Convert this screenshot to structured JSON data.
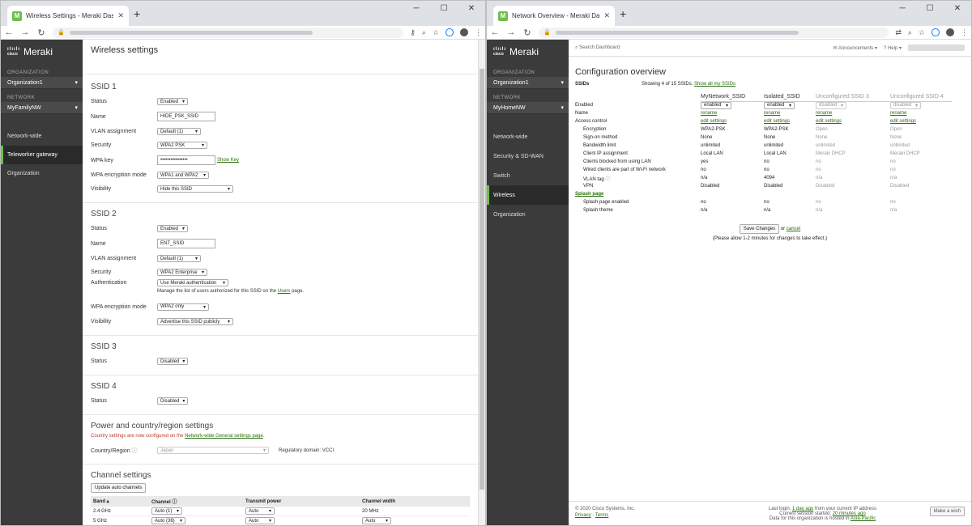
{
  "left": {
    "tab_title": "Wireless Settings - Meraki Dashb",
    "brand": "Meraki",
    "org_label": "ORGANIZATION",
    "org_value": "Organization1",
    "net_label": "NETWORK",
    "net_value": "MyFamilyNW",
    "nav": [
      "Network-wide",
      "Teleworker gateway",
      "Organization"
    ],
    "page_title": "Wireless settings",
    "ssid1": {
      "title": "SSID 1",
      "status_label": "Status",
      "status": "Enabled",
      "name_label": "Name",
      "name": "HIDE_PSK_SSID",
      "vlan_label": "VLAN assignment",
      "vlan": "Default (1)",
      "security_label": "Security",
      "security": "WPA2 PSK",
      "wpakey_label": "WPA key",
      "wpakey": "••••••••••••••••",
      "show_key": "Show Key",
      "enc_label": "WPA encryption mode",
      "enc": "WPA1 and WPA2",
      "vis_label": "Visibility",
      "vis": "Hide this SSID"
    },
    "ssid2": {
      "title": "SSID 2",
      "status_label": "Status",
      "status": "Enabled",
      "name_label": "Name",
      "name": "ENT_SSID",
      "vlan_label": "VLAN assignment",
      "vlan": "Default (1)",
      "security_label": "Security",
      "security": "WPA2 Enterprise",
      "auth_label": "Authentication",
      "auth": "Use Meraki authentication",
      "manage_pre": "Manage the list of users authorized for this SSID on the ",
      "manage_link": "Users",
      "manage_post": " page.",
      "enc_label": "WPA encryption mode",
      "enc": "WPA2 only",
      "vis_label": "Visibility",
      "vis": "Advertise this SSID publicly"
    },
    "ssid3": {
      "title": "SSID 3",
      "status_label": "Status",
      "status": "Disabled"
    },
    "ssid4": {
      "title": "SSID 4",
      "status_label": "Status",
      "status": "Disabled"
    },
    "power": {
      "title": "Power and country/region settings",
      "note_pre": "Country settings are now configured on the ",
      "note_link": "Network-wide General settings page",
      "note_post": ".",
      "country_label": "Country/Region",
      "country": "Japan",
      "reg": "Regulatory domain: VCCI"
    },
    "channel": {
      "title": "Channel settings",
      "update_btn": "Update auto channels",
      "headers": [
        "Band ▴",
        "Channel",
        "Transmit power",
        "Channel width"
      ],
      "rows": [
        {
          "band": "2.4 GHz",
          "channel": "Auto (1)",
          "power": "Auto",
          "width": "20 MHz"
        },
        {
          "band": "5 GHz",
          "channel": "Auto (36)",
          "power": "Auto",
          "width": "Auto"
        }
      ]
    }
  },
  "right": {
    "tab_title": "Network Overview - Meraki Dash",
    "brand": "Meraki",
    "org_label": "ORGANIZATION",
    "org_value": "Organization1",
    "net_label": "NETWORK",
    "net_value": "MyHomeNW",
    "nav": [
      "Network-wide",
      "Security & SD-WAN",
      "Switch",
      "Wireless",
      "Organization"
    ],
    "search": "Search Dashboard",
    "announcements": "Announcements",
    "help": "Help",
    "title": "Configuration overview",
    "ssids_label": "SSIDs",
    "showing": "Showing 4 of 15 SSIDs.",
    "show_all": "Show all my SSIDs",
    "columns": [
      "MyNetwork_SSID",
      "Isolated_SSID",
      "Unconfigured SSID 3",
      "Unconfigured SSID 4"
    ],
    "rows": [
      {
        "label": "Enabled",
        "indent": false,
        "vals": [
          "enabled",
          "enabled",
          "disabled",
          "disabled"
        ],
        "kind": "select"
      },
      {
        "label": "Name",
        "indent": false,
        "vals": [
          "rename",
          "rename",
          "rename",
          "rename"
        ],
        "kind": "link"
      },
      {
        "label": "Access control",
        "indent": false,
        "vals": [
          "edit settings",
          "edit settings",
          "edit settings",
          "edit settings"
        ],
        "kind": "link"
      },
      {
        "label": "Encryption",
        "indent": true,
        "vals": [
          "WPA2-PSK",
          "WPA2-PSK",
          "Open",
          "Open"
        ]
      },
      {
        "label": "Sign-on method",
        "indent": true,
        "vals": [
          "None",
          "None",
          "None",
          "None"
        ]
      },
      {
        "label": "Bandwidth limit",
        "indent": true,
        "vals": [
          "unlimited",
          "unlimited",
          "unlimited",
          "unlimited"
        ]
      },
      {
        "label": "Client IP assignment",
        "indent": true,
        "vals": [
          "Local LAN",
          "Local LAN",
          "Meraki DHCP",
          "Meraki DHCP"
        ]
      },
      {
        "label": "Clients blocked from using LAN",
        "indent": true,
        "vals": [
          "yes",
          "no",
          "no",
          "no"
        ]
      },
      {
        "label": "Wired clients are part of Wi-Fi network",
        "indent": true,
        "vals": [
          "no",
          "no",
          "no",
          "no"
        ]
      },
      {
        "label": "VLAN tag",
        "indent": true,
        "vals": [
          "n/a",
          "4094",
          "n/a",
          "n/a"
        ]
      },
      {
        "label": "VPN",
        "indent": true,
        "vals": [
          "Disabled",
          "Disabled",
          "Disabled",
          "Disabled"
        ]
      }
    ],
    "splash_label": "Splash page",
    "splash_rows": [
      {
        "label": "Splash page enabled",
        "vals": [
          "no",
          "no",
          "no",
          "no"
        ]
      },
      {
        "label": "Splash theme",
        "vals": [
          "n/a",
          "n/a",
          "n/a",
          "n/a"
        ]
      }
    ],
    "save_btn": "Save Changes",
    "or_text": "or",
    "cancel": "cancel",
    "allow_note": "(Please allow 1-2 minutes for changes to take effect.)",
    "footer": {
      "copyright": "© 2020 Cisco Systems, Inc.",
      "privacy": "Privacy",
      "dash": "-",
      "terms": "Terms",
      "last_login_pre": "Last login: ",
      "last_login_link": "1 day ago",
      "last_login_post": " from your current IP address",
      "session_pre": "Current session started: ",
      "session_link": "20 minutes ago",
      "hosted_pre": "Data for this organization is hosted in ",
      "hosted_link": "Asia-Pacific",
      "wish": "Make a wish"
    }
  }
}
